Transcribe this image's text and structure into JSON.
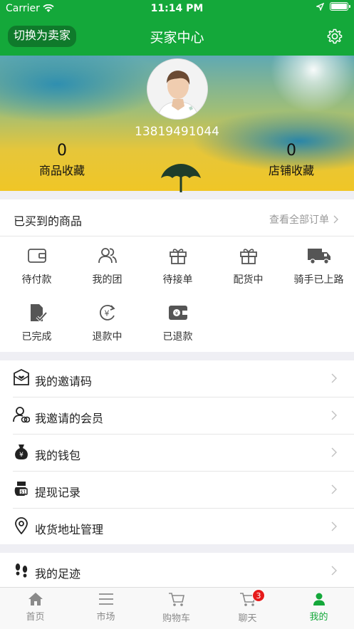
{
  "status": {
    "carrier": "Carrier",
    "time": "11:14 PM"
  },
  "nav": {
    "switch_label": "切换为卖家",
    "title": "买家中心",
    "settings_icon": "gear-icon"
  },
  "profile": {
    "phone": "13819491044",
    "product_fav_count": "0",
    "product_fav_label": "商品收藏",
    "shop_fav_count": "0",
    "shop_fav_label": "店铺收藏"
  },
  "orders": {
    "title": "已买到的商品",
    "view_all": "查看全部订单",
    "items": [
      {
        "label": "待付款",
        "icon": "wallet-icon"
      },
      {
        "label": "我的团",
        "icon": "group-icon"
      },
      {
        "label": "待接单",
        "icon": "gift-icon"
      },
      {
        "label": "配货中",
        "icon": "gift-icon"
      },
      {
        "label": "骑手已上路",
        "icon": "truck-icon"
      },
      {
        "label": "已完成",
        "icon": "document-check-icon"
      },
      {
        "label": "退款中",
        "icon": "yen-refresh-icon"
      },
      {
        "label": "已退款",
        "icon": "refund-wallet-icon"
      }
    ]
  },
  "menu": {
    "items": [
      {
        "label": "我的邀请码",
        "icon": "invite-envelope-icon"
      },
      {
        "label": "我邀请的会员",
        "icon": "member-icon"
      },
      {
        "label": "我的钱包",
        "icon": "money-bag-icon"
      },
      {
        "label": "提现记录",
        "icon": "withdraw-icon"
      },
      {
        "label": "收货地址管理",
        "icon": "location-pin-icon"
      }
    ],
    "footprint": {
      "label": "我的足迹",
      "icon": "footprint-icon"
    }
  },
  "tabbar": {
    "items": [
      {
        "label": "首页",
        "icon": "home-icon"
      },
      {
        "label": "市场",
        "icon": "menu-lines-icon"
      },
      {
        "label": "购物车",
        "icon": "cart-icon"
      },
      {
        "label": "聊天",
        "icon": "chat-cart-icon",
        "badge": "3"
      },
      {
        "label": "我的",
        "icon": "person-icon"
      }
    ],
    "active": "我的"
  },
  "colors": {
    "brand_green": "#14a83a",
    "badge_red": "#e61b1b"
  }
}
